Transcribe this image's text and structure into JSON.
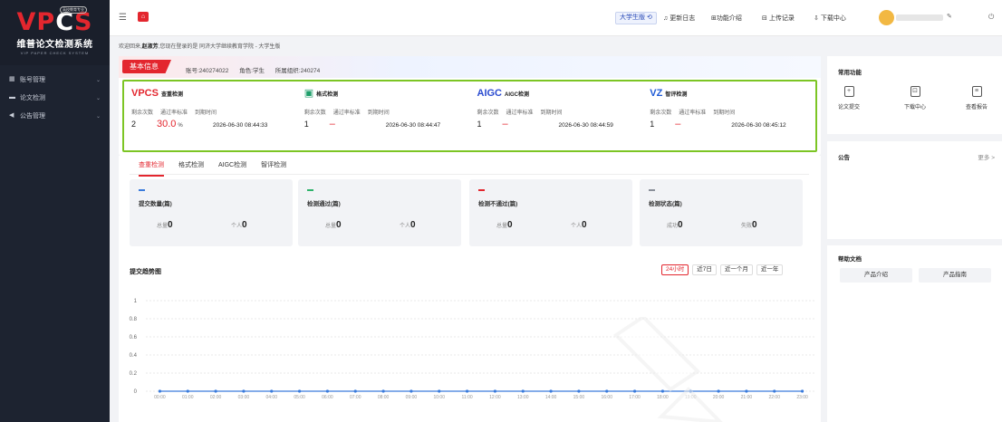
{
  "sidebar": {
    "logo_mark_red": "VP",
    "logo_mark_white": "C",
    "logo_mark_tail": "S",
    "logo_cn": "维普论文检测系统",
    "logo_en": "VIP PAPER CHECK SYSTEM",
    "logo_badge": "高校教育专业",
    "items": [
      {
        "label": "账号管理",
        "icon": "user-icon"
      },
      {
        "label": "论文检测",
        "icon": "document-icon"
      },
      {
        "label": "公告管理",
        "icon": "megaphone-icon"
      }
    ]
  },
  "topbar": {
    "edition": "大学生版",
    "changelog": "更新日志",
    "features": "功能介绍",
    "upload_records": "上传记录",
    "download_center": "下载中心"
  },
  "welcome": {
    "prefix": "欢迎回来,",
    "name": "赵淑芳",
    "suffix": ",您现在登录的是 同济大学继续教育学院 - 大学生版"
  },
  "basic_info": {
    "tag": "基本信息",
    "account": "账号:240274022",
    "role": "角色:学生",
    "org": "所属组织:240274"
  },
  "services": [
    {
      "logo": "VPCS",
      "logo_color": "#e3262e",
      "name": "查重检测",
      "remaining": "2",
      "rate": "30.0",
      "rate_unit": "%",
      "expire": "2026-06-30 08:44:33"
    },
    {
      "logo": "▣",
      "logo_color": "#1e9e6a",
      "name": "格式检测",
      "remaining": "1",
      "rate": "–",
      "rate_unit": "",
      "expire": "2026-06-30 08:44:47"
    },
    {
      "logo": "AIGC",
      "logo_color": "#2a4bd0",
      "name": "AIGC检测",
      "remaining": "1",
      "rate": "–",
      "rate_unit": "",
      "expire": "2026-06-30 08:44:59"
    },
    {
      "logo": "VZ",
      "logo_color": "#1f5bd6",
      "name": "智评检测",
      "remaining": "1",
      "rate": "–",
      "rate_unit": "",
      "expire": "2026-06-30 08:45:12"
    }
  ],
  "service_labels": {
    "remaining": "剩余次数",
    "rate": "通过率标准",
    "expire": "到期时间"
  },
  "tabs": [
    "查重检测",
    "格式检测",
    "AIGC检测",
    "智评检测"
  ],
  "stats": [
    {
      "title": "提交数量(篇)",
      "color": "#3a7bdc",
      "a_label": "总量",
      "a": "0",
      "b_label": "个人",
      "b": "0"
    },
    {
      "title": "检测通过(篇)",
      "color": "#2fb36b",
      "a_label": "总量",
      "a": "0",
      "b_label": "个人",
      "b": "0"
    },
    {
      "title": "检测不通过(篇)",
      "color": "#e3262e",
      "a_label": "总量",
      "a": "0",
      "b_label": "个人",
      "b": "0"
    },
    {
      "title": "检测状态(篇)",
      "color": "#8a8f99",
      "a_label": "成功",
      "a": "0",
      "b_label": "失败",
      "b": "0"
    }
  ],
  "trend": {
    "title": "提交趋势图",
    "ranges": [
      "24小时",
      "近7日",
      "近一个月",
      "近一年"
    ],
    "active_range": "24小时"
  },
  "chart_data": {
    "type": "line",
    "x": [
      "00:00",
      "01:00",
      "02:00",
      "03:00",
      "04:00",
      "05:00",
      "06:00",
      "07:00",
      "08:00",
      "09:00",
      "10:00",
      "11:00",
      "12:00",
      "13:00",
      "14:00",
      "15:00",
      "16:00",
      "17:00",
      "18:00",
      "19:00",
      "20:00",
      "21:00",
      "22:00",
      "23:00"
    ],
    "series": [
      {
        "values": [
          0,
          0,
          0,
          0,
          0,
          0,
          0,
          0,
          0,
          0,
          0,
          0,
          0,
          0,
          0,
          0,
          0,
          0,
          0,
          0,
          0,
          0,
          0,
          0
        ]
      }
    ],
    "yticks": [
      "0",
      "0.2",
      "0.4",
      "0.6",
      "0.8",
      "1"
    ],
    "ylim": [
      0,
      1
    ],
    "color": "#3a7bdc",
    "grid": true
  },
  "right": {
    "quick_title": "常用功能",
    "quick": [
      {
        "label": "论文提交",
        "icon": "upload-doc-icon"
      },
      {
        "label": "下载中心",
        "icon": "download-box-icon"
      },
      {
        "label": "查看报告",
        "icon": "report-icon"
      }
    ],
    "notice_title": "公告",
    "more": "更多 >",
    "help_title": "帮助文档",
    "help": [
      "产品介绍",
      "产品指南"
    ]
  }
}
